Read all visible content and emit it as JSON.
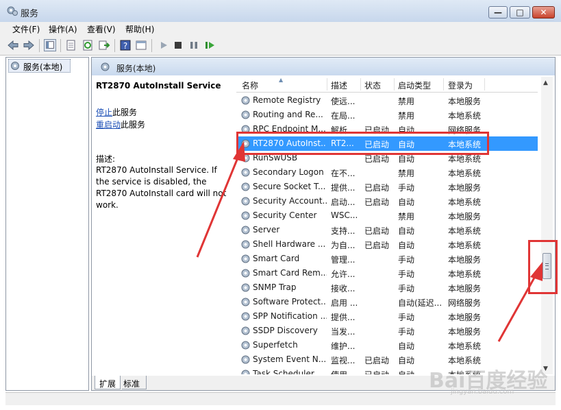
{
  "window": {
    "title": "服务",
    "minimize": "—",
    "maximize": "□",
    "close": "✕"
  },
  "menu": [
    "文件(F)",
    "操作(A)",
    "查看(V)",
    "帮助(H)"
  ],
  "tree": {
    "item": "服务(本地)"
  },
  "pane": {
    "header": "服务(本地)",
    "service_name": "RT2870 AutoInstall Service",
    "stop_link": "停止",
    "stop_suffix": "此服务",
    "restart_link": "重启动",
    "restart_suffix": "此服务",
    "desc_label": "描述:",
    "desc_text": "RT2870 AutoInstall Service. If the service is disabled, the RT2870 AutoInstall card will not work."
  },
  "list": {
    "columns": [
      "名称",
      "描述",
      "状态",
      "启动类型",
      "登录为"
    ],
    "rows": [
      [
        "Remote Registry",
        "使远...",
        "",
        "禁用",
        "本地服务"
      ],
      [
        "Routing and Re...",
        "在局...",
        "",
        "禁用",
        "本地系统"
      ],
      [
        "RPC Endpoint M...",
        "解析...",
        "已启动",
        "自动",
        "网络服务"
      ],
      [
        "RT2870 AutoInst...",
        "RT2...",
        "已启动",
        "自动",
        "本地系统"
      ],
      [
        "RunSwUSB",
        "",
        "已启动",
        "自动",
        "本地系统"
      ],
      [
        "Secondary Logon",
        "在不...",
        "",
        "禁用",
        "本地系统"
      ],
      [
        "Secure Socket T...",
        "提供...",
        "已启动",
        "手动",
        "本地服务"
      ],
      [
        "Security Account...",
        "启动...",
        "已启动",
        "自动",
        "本地系统"
      ],
      [
        "Security Center",
        "WSC...",
        "",
        "禁用",
        "本地服务"
      ],
      [
        "Server",
        "支持...",
        "已启动",
        "自动",
        "本地系统"
      ],
      [
        "Shell Hardware ...",
        "为自...",
        "已启动",
        "自动",
        "本地系统"
      ],
      [
        "Smart Card",
        "管理...",
        "",
        "手动",
        "本地服务"
      ],
      [
        "Smart Card Rem...",
        "允许...",
        "",
        "手动",
        "本地系统"
      ],
      [
        "SNMP Trap",
        "接收...",
        "",
        "手动",
        "本地服务"
      ],
      [
        "Software Protect...",
        "启用 ...",
        "",
        "自动(延迟...",
        "网络服务"
      ],
      [
        "SPP Notification ...",
        "提供...",
        "",
        "手动",
        "本地服务"
      ],
      [
        "SSDP Discovery",
        "当发...",
        "",
        "手动",
        "本地服务"
      ],
      [
        "Superfetch",
        "维护...",
        "",
        "自动",
        "本地系统"
      ],
      [
        "System Event N...",
        "监视...",
        "已启动",
        "自动",
        "本地系统"
      ],
      [
        "Task Scheduler",
        "使用...",
        "已启动",
        "自动",
        "本地系统"
      ]
    ],
    "selected_index": 3
  },
  "tabs": [
    "扩展",
    "标准"
  ],
  "watermark": {
    "logo": "Bai百度经验",
    "url": "jingyan.baidu.com"
  },
  "colors": {
    "selection": "#3399ff",
    "annotation": "#e03535"
  }
}
